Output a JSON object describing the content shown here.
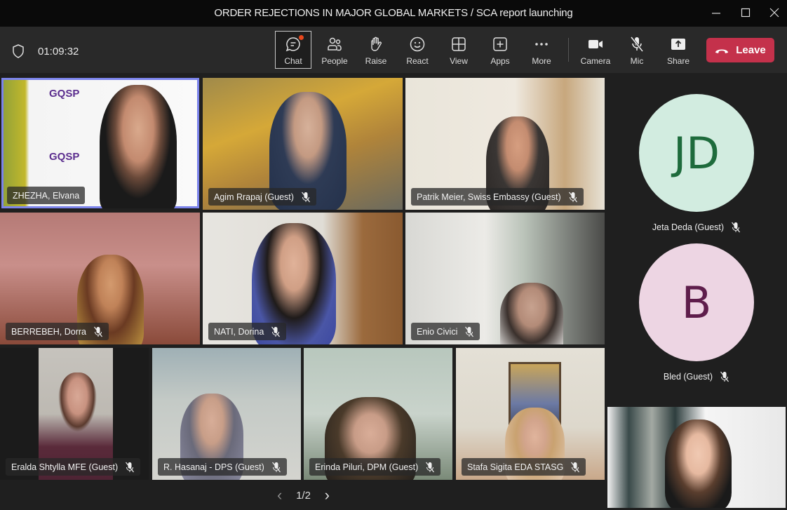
{
  "window": {
    "title": "ORDER REJECTIONS IN MAJOR GLOBAL MARKETS / SCA report launching",
    "minimize_icon": "minimize-icon",
    "maximize_icon": "maximize-icon",
    "close_icon": "close-icon"
  },
  "toolbar": {
    "timer": "01:09:32",
    "buttons": [
      {
        "label": "Chat",
        "icon": "chat-icon",
        "active": true,
        "badge": true
      },
      {
        "label": "People",
        "icon": "people-icon"
      },
      {
        "label": "Raise",
        "icon": "raise-hand-icon"
      },
      {
        "label": "React",
        "icon": "smiley-icon"
      },
      {
        "label": "View",
        "icon": "grid-view-icon"
      },
      {
        "label": "Apps",
        "icon": "apps-plus-icon"
      },
      {
        "label": "More",
        "icon": "more-dots-icon"
      },
      {
        "label": "Camera",
        "icon": "camera-icon"
      },
      {
        "label": "Mic",
        "icon": "mic-off-icon"
      },
      {
        "label": "Share",
        "icon": "share-icon"
      }
    ],
    "leave_label": "Leave",
    "leave_color": "#c4314b"
  },
  "participants": [
    {
      "name": "ZHEZHA, Elvana",
      "muted": false,
      "speaking": true
    },
    {
      "name": "Agim Rrapaj (Guest)",
      "muted": true
    },
    {
      "name": "Patrik Meier, Swiss Embassy (Guest)",
      "muted": true
    },
    {
      "name": "BERREBEH, Dorra",
      "muted": true
    },
    {
      "name": "NATI, Dorina",
      "muted": true
    },
    {
      "name": "Enio Civici",
      "muted": true
    },
    {
      "name": "Eralda Shtylla MFE (Guest)",
      "muted": true
    },
    {
      "name": "R. Hasanaj - DPS (Guest)",
      "muted": true
    },
    {
      "name": "Erinda Piluri, DPM (Guest)",
      "muted": true
    },
    {
      "name": "Stafa Sigita EDA STASG",
      "muted": true
    }
  ],
  "avatars": [
    {
      "initials": "JD",
      "name": "Jeta Deda (Guest)",
      "bg": "#d2ece0",
      "fg": "#1e6b3c",
      "muted": true
    },
    {
      "initials": "B",
      "name": "Bled (Guest)",
      "bg": "#edd5e3",
      "fg": "#5e1d4b",
      "muted": true
    }
  ],
  "pager": {
    "prev": "‹",
    "label": "1/2",
    "next": "›"
  }
}
